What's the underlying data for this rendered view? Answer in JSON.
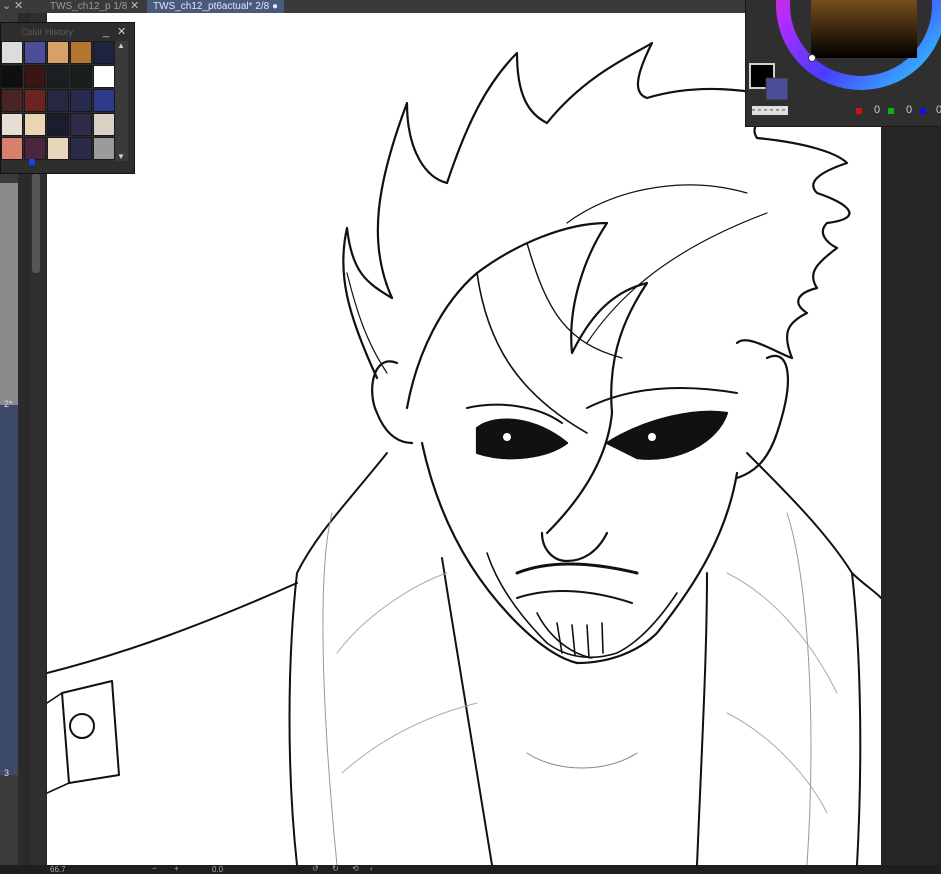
{
  "tabs": [
    {
      "label": "TWS_ch12_p  1/8"
    },
    {
      "label": "TWS_ch12_pt6actual*  2/8 ●"
    }
  ],
  "history": {
    "title": "Color History",
    "swatches": [
      "#dcdcdc",
      "#4d4e99",
      "#d7a067",
      "#b3752f",
      "#1f2340",
      "#0f0f0f",
      "#3b1512",
      "#1a2022",
      "#18201e",
      "#ffffff",
      "#4a2422",
      "#6c2420",
      "#262840",
      "#262a4c",
      "#2b3b8a",
      "#e8ddd2",
      "#e9d5b3",
      "#1c1c2f",
      "#2e2a48",
      "#d9d1c4",
      "#d8806b",
      "#4b263b",
      "#e8d6bc",
      "#2b2a4a",
      "#9b9b9b"
    ]
  },
  "color_panel": {
    "rgb_values": [
      "0",
      "0",
      "0"
    ]
  },
  "sidebar": {
    "label_2": "2*",
    "label_3": "3"
  },
  "status": {
    "zoom": "66.7",
    "rotate": "0.0"
  }
}
